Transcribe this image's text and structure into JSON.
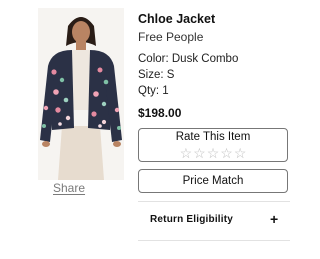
{
  "product": {
    "title": "Chloe Jacket",
    "brand": "Free People",
    "color_line": "Color: Dusk Combo",
    "size_line": "Size: S",
    "qty_line": "Qty: 1",
    "price": "$198.00",
    "image_alt": "Model wearing floral quilted jacket"
  },
  "share": {
    "label": "Share"
  },
  "rating": {
    "label": "Rate This Item",
    "stars": [
      "☆",
      "☆",
      "☆",
      "☆",
      "☆"
    ],
    "current_rating": 0,
    "max_rating": 5
  },
  "price_match": {
    "label": "Price Match"
  },
  "return_eligibility": {
    "label": "Return Eligibility",
    "toggle_icon": "+",
    "expanded": false
  },
  "colors": {
    "accent_text": "#111111",
    "muted_text": "#7a7a7a",
    "border": "#777777",
    "star_empty": "#bfbfbf"
  },
  "icons": {
    "star": "star-outline-icon",
    "expand": "plus-icon"
  }
}
